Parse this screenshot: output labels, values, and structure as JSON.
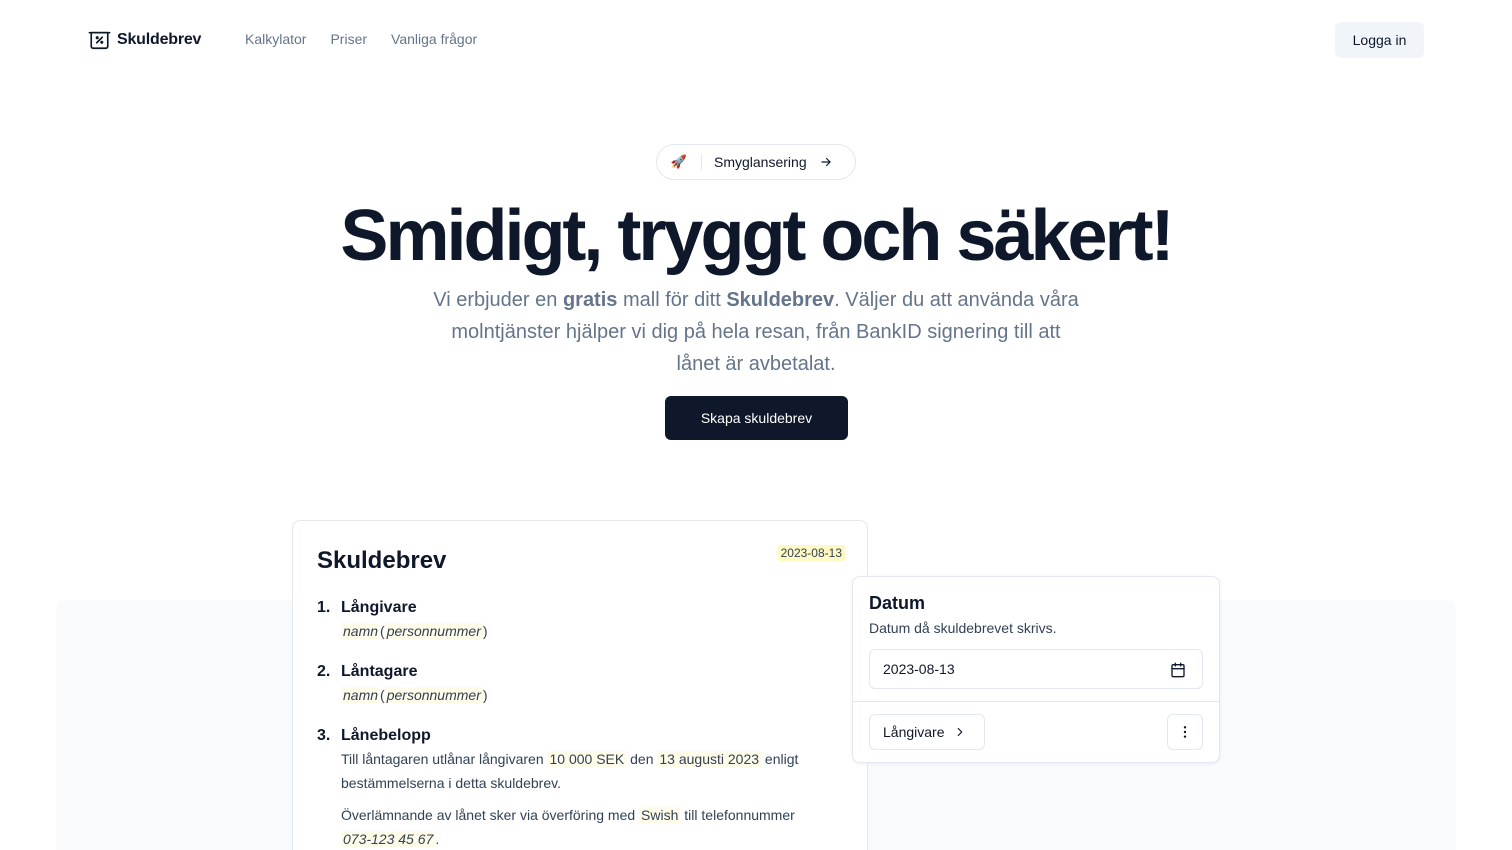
{
  "nav": {
    "brand": "Skuldebrev",
    "links": [
      "Kalkylator",
      "Priser",
      "Vanliga frågor"
    ],
    "login_label": "Logga in"
  },
  "hero": {
    "pill_icon": "🚀",
    "pill_label": "Smyglansering",
    "title": "Smidigt, tryggt och säkert!",
    "subtitle_parts": [
      "Vi erbjuder en ",
      "gratis",
      " mall för ditt ",
      "Skuldebrev",
      ". Väljer du att använda våra molntjänster hjälper vi dig på hela resan, från BankID signering till att lånet är avbetalat."
    ],
    "cta_label": "Skapa skuldebrev"
  },
  "document": {
    "title": "Skuldebrev",
    "date": "2023-08-13",
    "sections": [
      {
        "num": "1.",
        "heading": "Långivare",
        "name": "namn",
        "id": "personnummer"
      },
      {
        "num": "2.",
        "heading": "Låntagare",
        "name": "namn",
        "id": "personnummer"
      },
      {
        "num": "3.",
        "heading": "Lånebelopp"
      }
    ],
    "loan": {
      "line1_a": "Till låntagaren utlånar långivaren ",
      "amount": "10 000 SEK",
      "line1_b": " den ",
      "date_text": "13 augusti 2023",
      "line1_c": " enligt",
      "line2": "bestämmelserna i detta skuldebrev.",
      "line3_a": "Överlämnande av lånet sker via överföring med ",
      "method": "Swish",
      "line3_b": " till telefonnummer",
      "phone": "073-123 45 67",
      "phone_suffix": "."
    }
  },
  "form": {
    "title": "Datum",
    "description": "Datum då skuldebrevet skrivs.",
    "date_value": "2023-08-13",
    "next_label": "Långivare"
  },
  "colors": {
    "primary": "#0f172a",
    "muted": "#64748b",
    "border": "#e2e8f0",
    "highlight": "#fef9c3"
  }
}
